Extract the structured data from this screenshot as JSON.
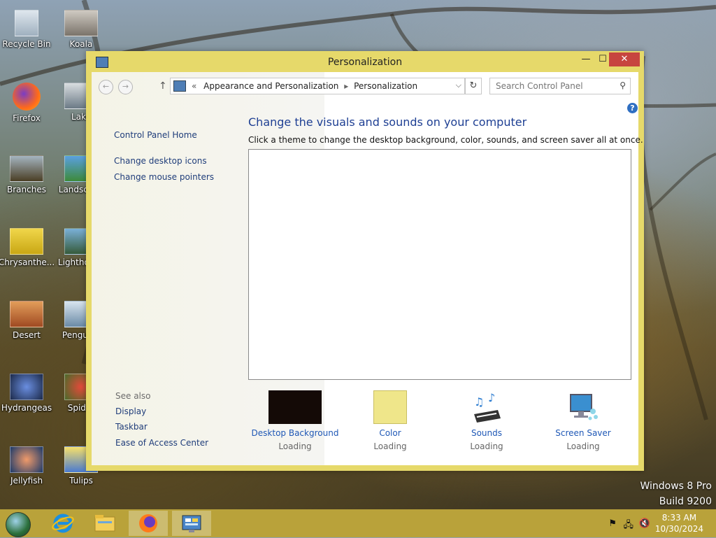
{
  "desktop": {
    "icons": [
      {
        "label": "Recycle Bin"
      },
      {
        "label": "Koala"
      },
      {
        "label": "Firefox"
      },
      {
        "label": "Lake"
      },
      {
        "label": "Branches"
      },
      {
        "label": "Landscape"
      },
      {
        "label": "Chrysanthe..."
      },
      {
        "label": "Lighthouse"
      },
      {
        "label": "Desert"
      },
      {
        "label": "Penguins"
      },
      {
        "label": "Hydrangeas"
      },
      {
        "label": "Spider"
      },
      {
        "label": "Jellyfish"
      },
      {
        "label": "Tulips"
      }
    ],
    "watermark": {
      "line1": "Windows 8 Pro",
      "line2": "Build 9200"
    }
  },
  "window": {
    "title": "Personalization",
    "controls": {
      "minimize": "—",
      "maximize": "☐",
      "close": "✕"
    },
    "nav": {
      "back": "←",
      "forward": "→",
      "up": "↑",
      "crumb_prefix": "«",
      "breadcrumb": [
        "Appearance and Personalization",
        "Personalization"
      ],
      "crumb_separator": "▸",
      "dropdown": "⌵",
      "refresh": "↻",
      "search_placeholder": "Search Control Panel",
      "search_icon": "⚲"
    },
    "help_icon": "?",
    "left_tasks": [
      {
        "label": "Control Panel Home"
      },
      {
        "label": "Change desktop icons"
      },
      {
        "label": "Change mouse pointers"
      }
    ],
    "see_also": {
      "heading": "See also",
      "items": [
        {
          "label": "Display"
        },
        {
          "label": "Taskbar"
        },
        {
          "label": "Ease of Access Center"
        }
      ]
    },
    "main": {
      "title": "Change the visuals and sounds on your computer",
      "subtitle": "Click a theme to change the desktop background, color, sounds, and screen saver all at once."
    },
    "settings": [
      {
        "label": "Desktop Background",
        "status": "Loading",
        "icon": "desktop-background-icon"
      },
      {
        "label": "Color",
        "status": "Loading",
        "icon": "color-icon"
      },
      {
        "label": "Sounds",
        "status": "Loading",
        "icon": "sounds-icon"
      },
      {
        "label": "Screen Saver",
        "status": "Loading",
        "icon": "screen-saver-icon"
      }
    ]
  },
  "taskbar": {
    "apps": [
      {
        "name": "Internet Explorer",
        "icon": "ie-icon"
      },
      {
        "name": "File Explorer",
        "icon": "folder-icon"
      },
      {
        "name": "Firefox",
        "icon": "firefox-icon"
      },
      {
        "name": "Control Panel",
        "icon": "control-panel-icon"
      }
    ],
    "tray": {
      "flag": "⚑",
      "network": "🖧",
      "volume": "🔇"
    },
    "clock": {
      "time": "8:33 AM",
      "date": "10/30/2024"
    }
  },
  "colors": {
    "window_frame": "#e6d96a",
    "close_button": "#c7453f",
    "taskbar": "#b9a23a",
    "link": "#1f58b6",
    "heading": "#1e3f93"
  }
}
